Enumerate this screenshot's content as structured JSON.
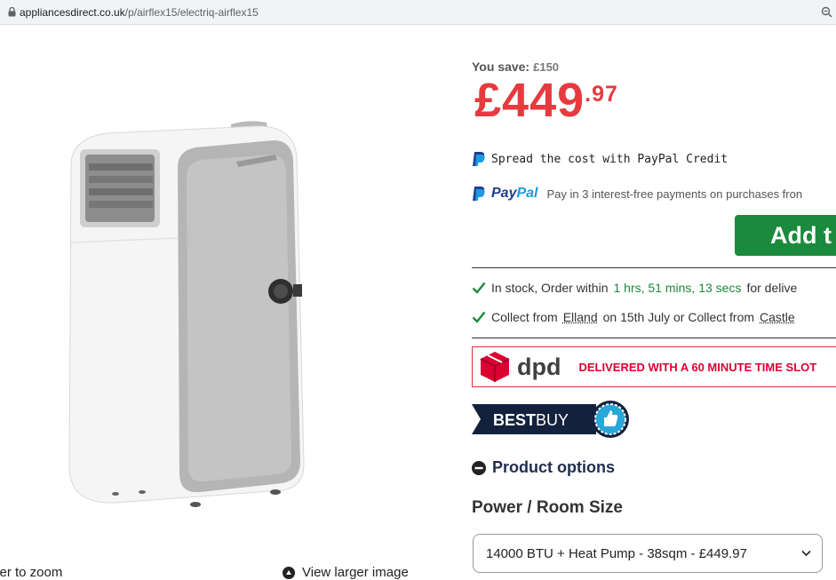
{
  "browser": {
    "url_host": "appliancesdirect.co.uk",
    "url_path": "/p/airflex15/electriq-airflex15",
    "lock_icon": "lock-icon",
    "zoom_icon": "zoom-icon"
  },
  "gallery": {
    "zoom_hint": "ver to zoom",
    "view_larger_label": "View larger image"
  },
  "pricing": {
    "save_label": "You save:",
    "save_amount": "£150",
    "price_main": "£449",
    "price_pence": ".97",
    "price_color": "#e73a3f"
  },
  "finance": {
    "paypal_credit_text": "Spread the cost with PayPal Credit",
    "paypal_brand_pay": "Pay",
    "paypal_brand_pal": "Pal",
    "paypal_pay3_text": "Pay in 3 interest-free payments on purchases fron"
  },
  "cart": {
    "add_label": "Add t",
    "button_color": "#1b8a3c"
  },
  "availability": {
    "stock_prefix": "In stock, Order within",
    "stock_timer": "1 hrs, 51 mins, 13 secs",
    "stock_suffix": "for delive",
    "collect_prefix": "Collect from",
    "collect_store": "Elland",
    "collect_middle": "on 15th July or Collect from",
    "collect_store2": "Castle"
  },
  "delivery": {
    "dpd_logo_text": "dpd",
    "dpd_message": "DELIVERED WITH A 60 MINUTE TIME SLOT"
  },
  "badge": {
    "best": "BEST",
    "buy": "BUY"
  },
  "options": {
    "heading": "Product options",
    "size_label": "Power / Room Size",
    "selected_option": "14000 BTU + Heat Pump - 38sqm - £449.97"
  }
}
